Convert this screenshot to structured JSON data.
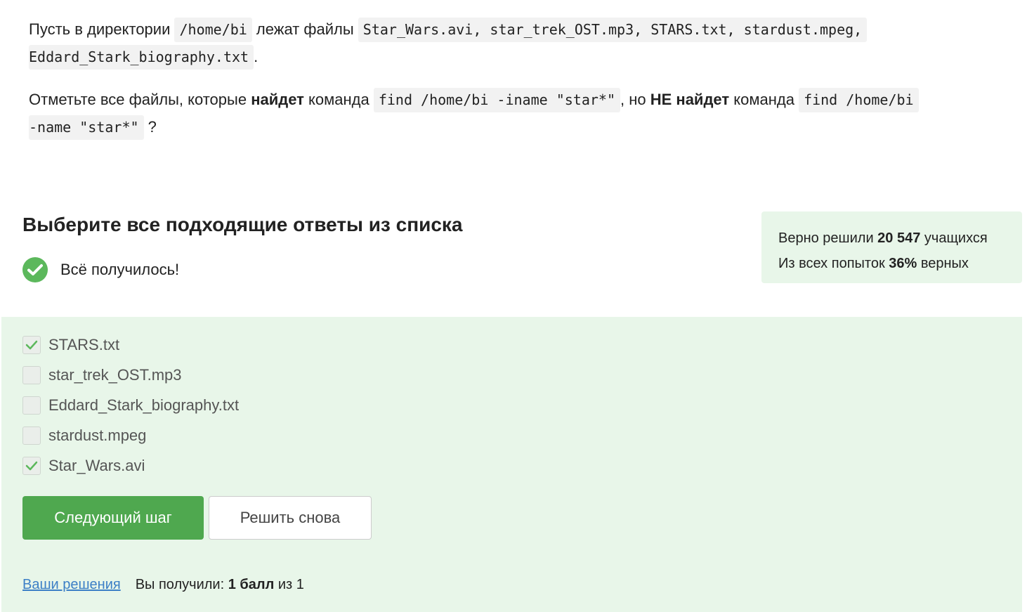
{
  "question": {
    "line1": {
      "t1": "Пусть в директории ",
      "code1": "/home/bi",
      "t2": " лежат файлы ",
      "code2": "Star_Wars.avi, star_trek_OST.mp3, STARS.txt, stardust.mpeg,"
    },
    "line2": {
      "code1": "Eddard_Stark_biography.txt",
      "t1": "."
    },
    "line3": {
      "t1": "Отметьте все файлы, которые ",
      "b1": "найдет",
      "t2": " команда ",
      "code1": "find /home/bi -iname \"star*\"",
      "t3": ", но ",
      "b2": "НЕ найдет",
      "t4": " команда ",
      "code2": "find /home/bi"
    },
    "line4": {
      "code1": "-name \"star*\"",
      "t1": " ?"
    }
  },
  "heading": "Выберите все подходящие ответы из списка",
  "status": {
    "text": "Всё получилось!",
    "icon": "check-circle-icon",
    "color": "#5cb85c"
  },
  "stats": {
    "line1_prefix": "Верно решили ",
    "line1_value": "20 547",
    "line1_suffix": " учащихся",
    "line2_prefix": "Из всех попыток ",
    "line2_value": "36%",
    "line2_suffix": " верных"
  },
  "options": [
    {
      "label": "STARS.txt",
      "checked": true
    },
    {
      "label": "star_trek_OST.mp3",
      "checked": false
    },
    {
      "label": "Eddard_Stark_biography.txt",
      "checked": false
    },
    {
      "label": "stardust.mpeg",
      "checked": false
    },
    {
      "label": "Star_Wars.avi",
      "checked": true
    }
  ],
  "buttons": {
    "next": "Следующий шаг",
    "retry": "Решить снова"
  },
  "footer": {
    "link": "Ваши решения",
    "score_prefix": "Вы получили: ",
    "score_value": "1 балл",
    "score_suffix": " из 1"
  },
  "colors": {
    "success_bg": "#e8f6e9",
    "accent": "#4fa84f",
    "link": "#3c7fc6"
  }
}
